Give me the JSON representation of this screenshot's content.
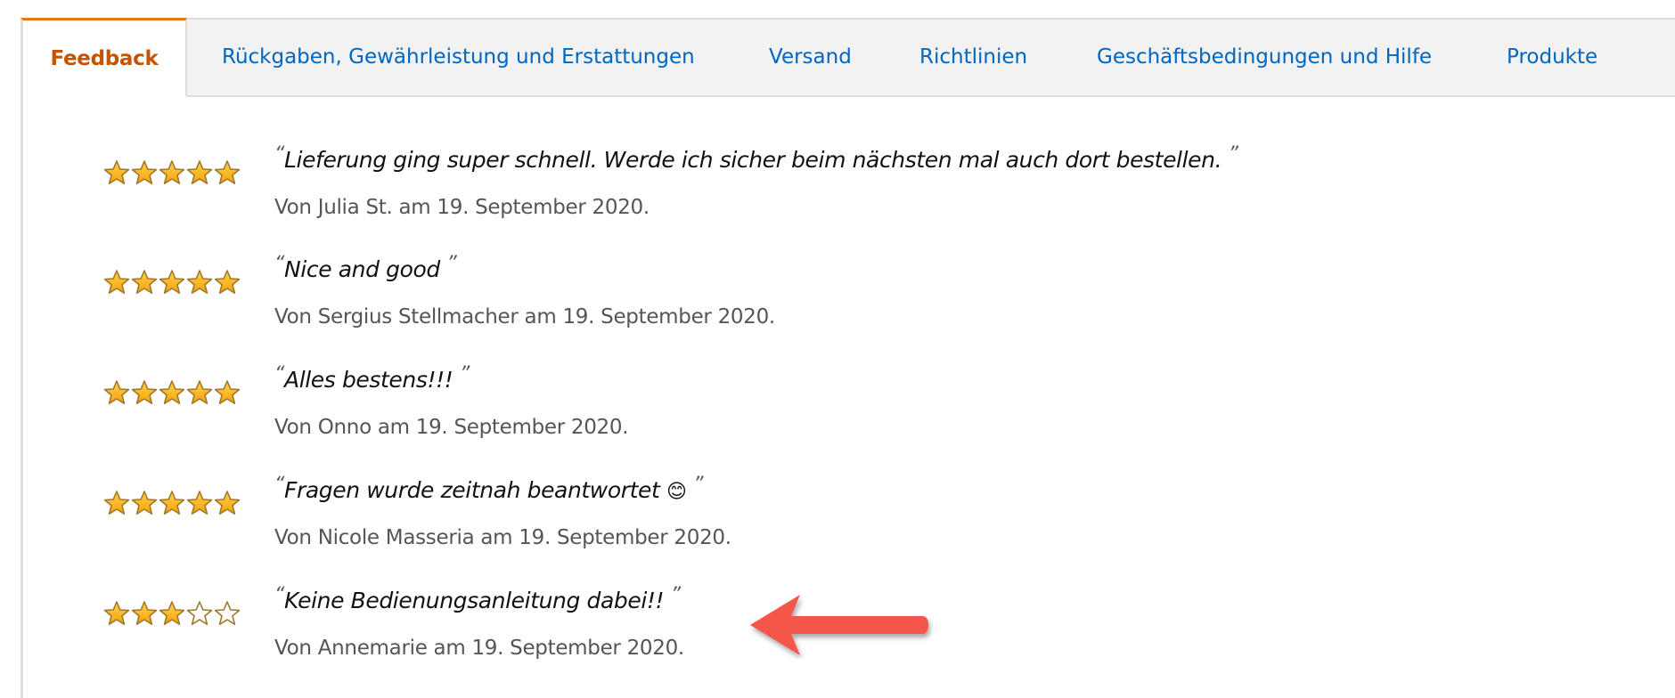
{
  "tabs": [
    {
      "label": "Feedback",
      "active": true
    },
    {
      "label": "Rückgaben, Gewährleistung und Erstattungen",
      "active": false
    },
    {
      "label": "Versand",
      "active": false
    },
    {
      "label": "Richtlinien",
      "active": false
    },
    {
      "label": "Geschäftsbedingungen und Hilfe",
      "active": false
    },
    {
      "label": "Produkte",
      "active": false
    }
  ],
  "colors": {
    "active_tab": "#c45500",
    "active_tab_border": "#e47911",
    "link": "#0066c0",
    "star_fill": "#ffb400",
    "star_stroke": "#a0782a",
    "annotation_arrow": "#f4574a"
  },
  "quote_open": "“",
  "quote_close": "”",
  "reviews": [
    {
      "rating": 5,
      "max_rating": 5,
      "text": "Lieferung ging super schnell. Werde ich sicher beim nächsten mal auch dort bestellen.",
      "emoji": "",
      "byline": "Von Julia St. am 19. September 2020."
    },
    {
      "rating": 5,
      "max_rating": 5,
      "text": "Nice and good",
      "emoji": "",
      "byline": "Von Sergius Stellmacher am 19. September 2020."
    },
    {
      "rating": 5,
      "max_rating": 5,
      "text": "Alles bestens!!!",
      "emoji": "",
      "byline": "Von Onno am 19. September 2020."
    },
    {
      "rating": 5,
      "max_rating": 5,
      "text": "Fragen wurde zeitnah beantwortet",
      "emoji": "😊",
      "byline": "Von Nicole Masseria am 19. September 2020."
    },
    {
      "rating": 3,
      "max_rating": 5,
      "text": "Keine Bedienungsanleitung dabei!!",
      "emoji": "",
      "byline": "Von Annemarie am 19. September 2020."
    }
  ],
  "annotation": {
    "icon": "left-arrow-icon",
    "points_to_review": 5
  }
}
